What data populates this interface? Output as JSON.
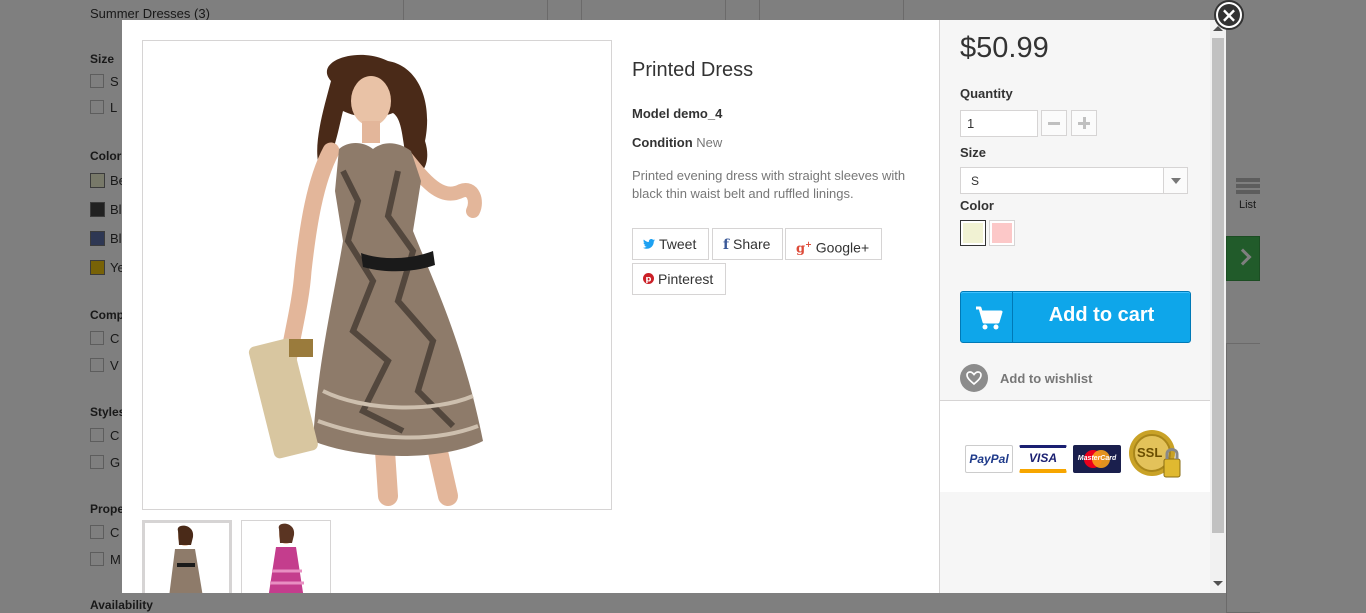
{
  "background": {
    "subcategory": "Summer Dresses (3)",
    "filters": [
      {
        "title": "Size",
        "items": [
          "S",
          "L"
        ]
      },
      {
        "title": "Color",
        "items": [
          "Be",
          "Bl",
          "Bl",
          "Ye"
        ],
        "swatches": [
          "#f1f2d3",
          "#434343",
          "#5d6ea6",
          "#f1c40f"
        ]
      },
      {
        "title": "Comp",
        "items": [
          "C",
          "V"
        ]
      },
      {
        "title": "Styles",
        "items": [
          "C",
          "G"
        ]
      },
      {
        "title": "Prope",
        "items": [
          "C",
          "M"
        ]
      }
    ],
    "availability": "Availability",
    "list_label": "List"
  },
  "product": {
    "name": "Printed Dress",
    "model_label": "Model",
    "model_value": "demo_4",
    "condition_label": "Condition",
    "condition_value": "New",
    "description": "Printed evening dress with straight sleeves with black thin waist belt and ruffled linings.",
    "social": {
      "tweet": "Tweet",
      "share": "Share",
      "google": "Google+",
      "pinterest": "Pinterest"
    }
  },
  "box": {
    "price": "$50.99",
    "quantity_label": "Quantity",
    "quantity_value": "1",
    "size_label": "Size",
    "size_value": "S",
    "color_label": "Color",
    "colors": [
      "#f1f2d3",
      "#fcc8c8"
    ],
    "add_to_cart": "Add to cart",
    "wishlist": "Add to wishlist",
    "payment": {
      "paypal": "PayPal",
      "visa": "VISA",
      "mastercard": "MasterCard",
      "ssl": "SSL"
    }
  },
  "icons": {
    "close": "close-icon",
    "cart": "cart-icon",
    "heart": "heart-icon",
    "twitter": "twitter-icon",
    "facebook": "facebook-icon",
    "googleplus": "googleplus-icon",
    "pinterest": "pinterest-icon"
  }
}
